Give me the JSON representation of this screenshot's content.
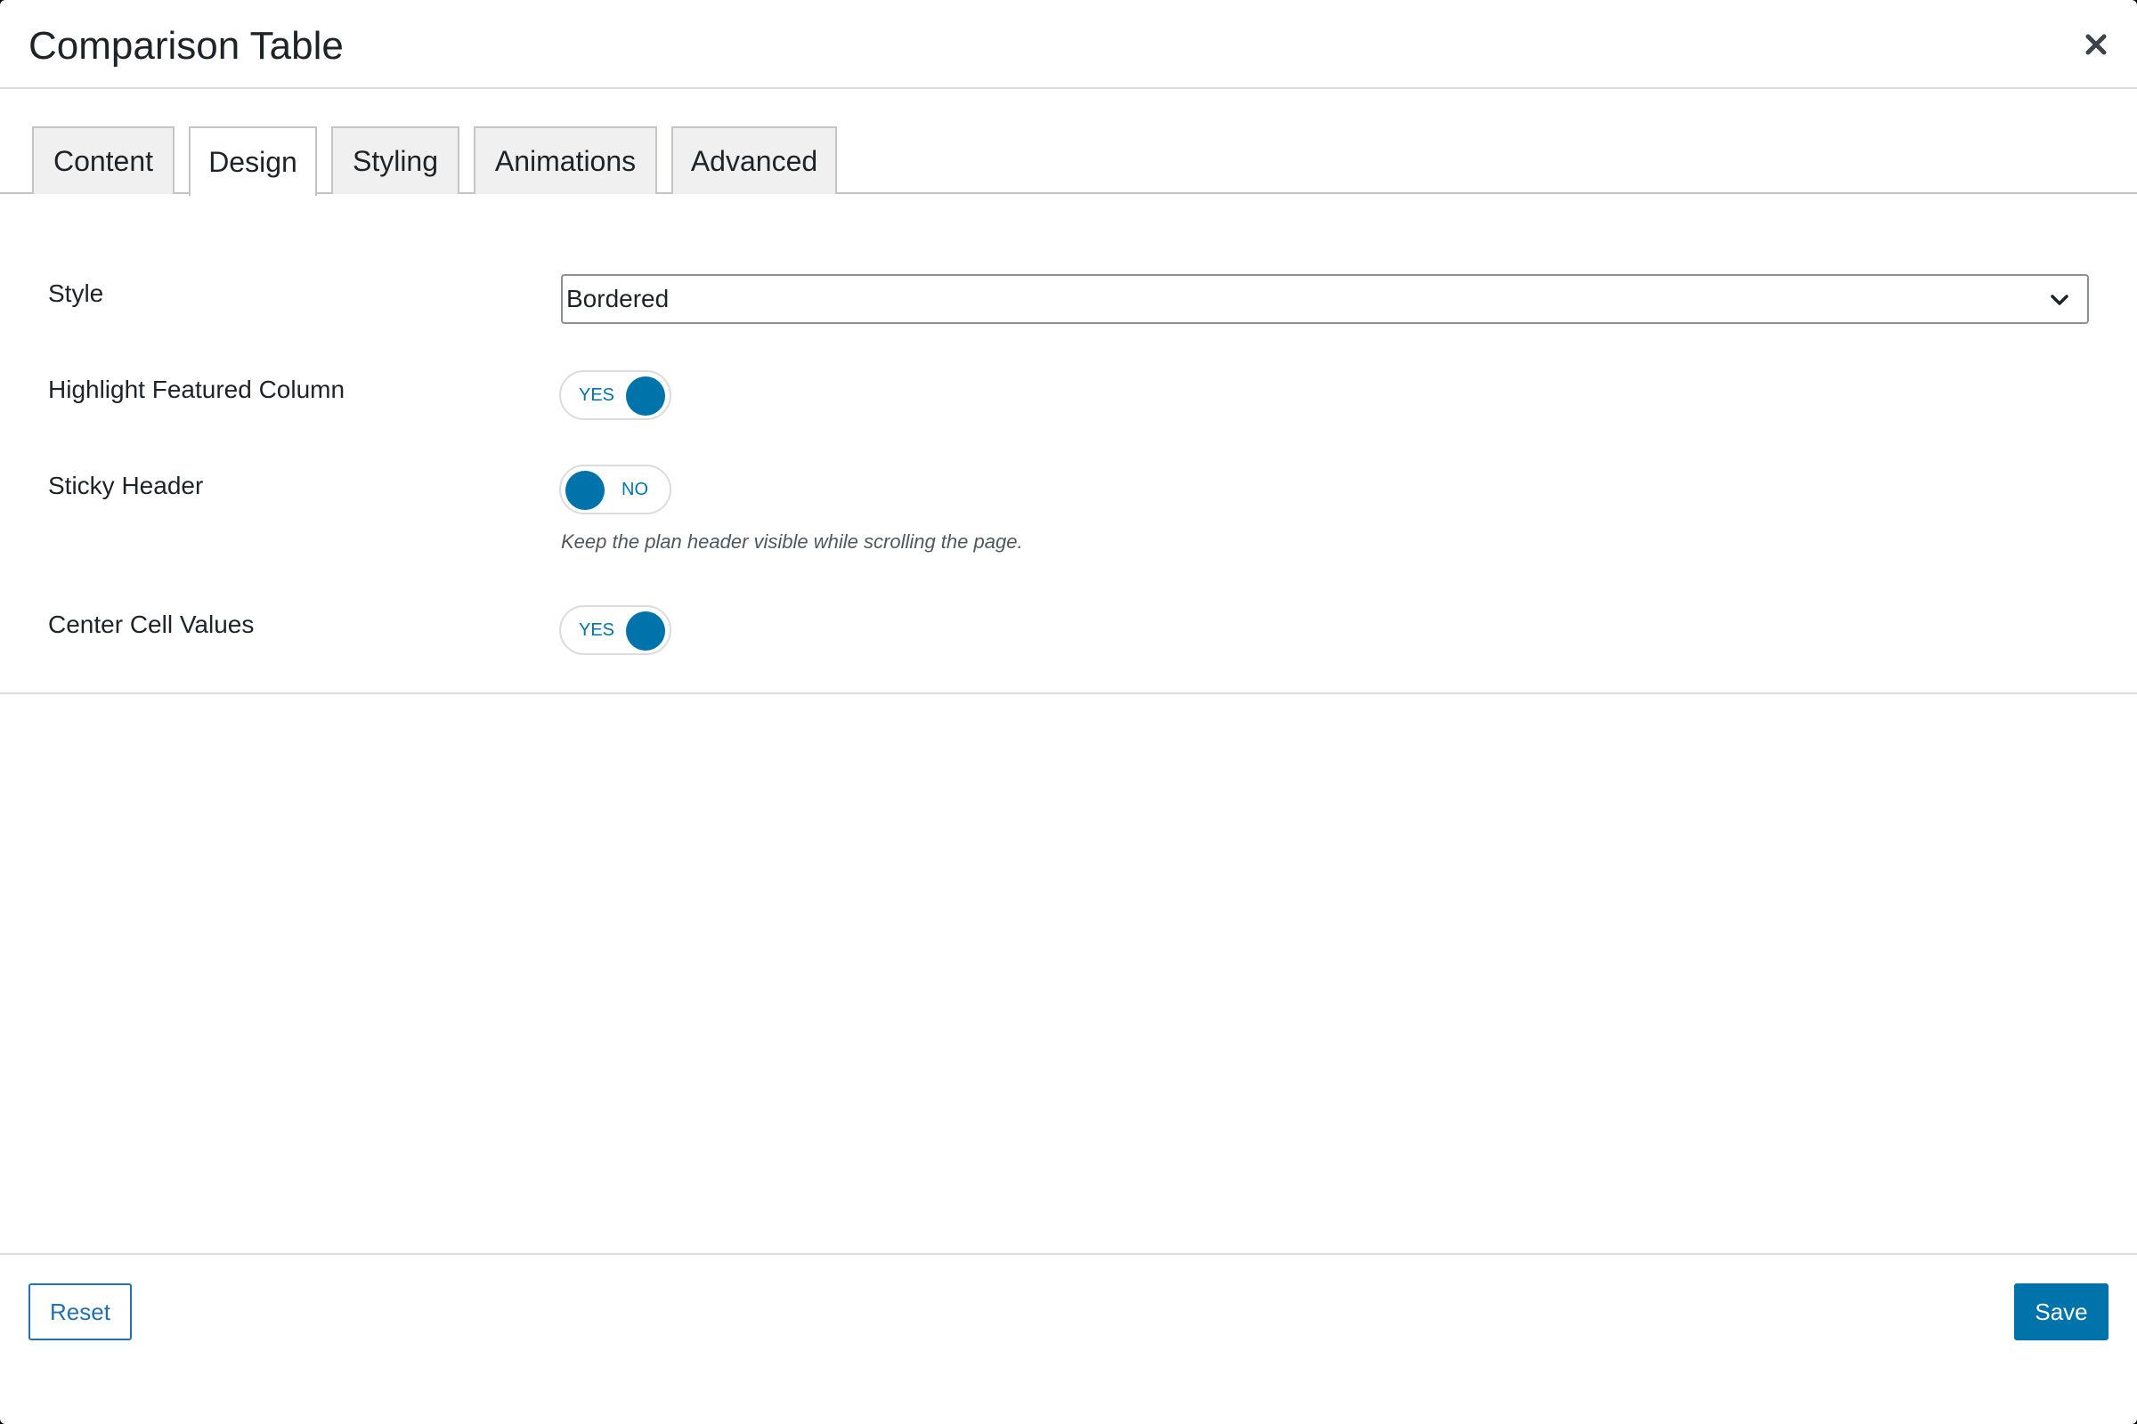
{
  "dialog": {
    "title": "Comparison Table",
    "close_icon": "close-icon"
  },
  "tabs": [
    {
      "label": "Content",
      "active": false
    },
    {
      "label": "Design",
      "active": true
    },
    {
      "label": "Styling",
      "active": false
    },
    {
      "label": "Animations",
      "active": false
    },
    {
      "label": "Advanced",
      "active": false
    }
  ],
  "form": {
    "style": {
      "label": "Style",
      "value": "Bordered",
      "icon": "chevron-down-icon"
    },
    "highlight_featured_column": {
      "label": "Highlight Featured Column",
      "state": "YES"
    },
    "sticky_header": {
      "label": "Sticky Header",
      "state": "NO",
      "help": "Keep the plan header visible while scrolling the page."
    },
    "center_cell_values": {
      "label": "Center Cell Values",
      "state": "YES"
    }
  },
  "footer": {
    "reset_label": "Reset",
    "save_label": "Save"
  },
  "colors": {
    "accent": "#0073aa",
    "border": "#c3c4c7",
    "text": "#1d2327"
  }
}
